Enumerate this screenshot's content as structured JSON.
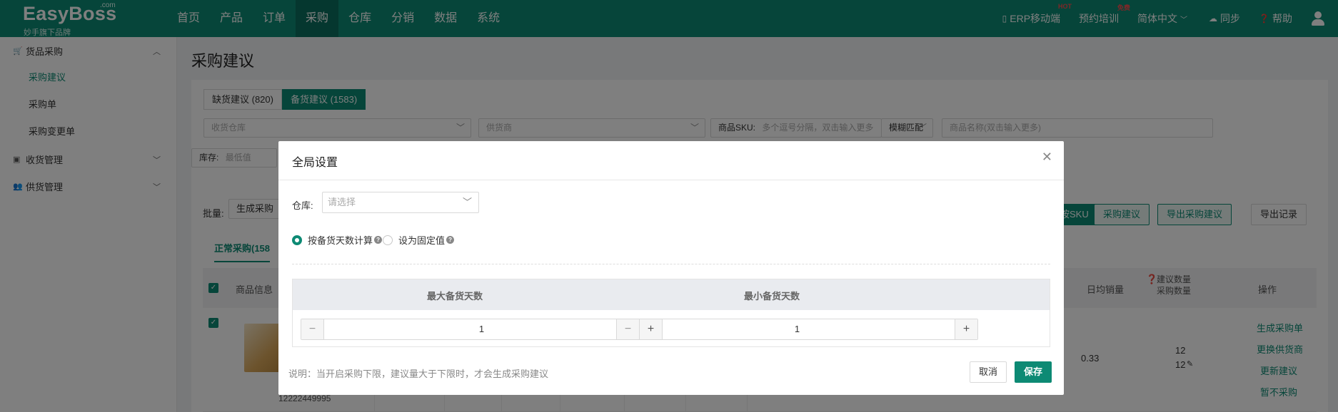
{
  "brand": {
    "name": "EasyBoss",
    "com": ".com",
    "slogan": "妙手旗下品牌"
  },
  "nav": {
    "items": [
      "首页",
      "产品",
      "订单",
      "采购",
      "仓库",
      "分销",
      "数据",
      "系统"
    ],
    "active": "采购"
  },
  "top_right": {
    "erp": "ERP移动端",
    "erp_badge": "HOT",
    "training": "预约培训",
    "training_badge": "免费",
    "language": "简体中文",
    "sync": "同步",
    "help": "帮助"
  },
  "sidebar": {
    "group_purchase": "货品采购",
    "items": [
      "采购建议",
      "采购单",
      "采购变更单"
    ],
    "group_receive": "收货管理",
    "group_supplier": "供货管理"
  },
  "page": {
    "title": "采购建议",
    "tab_shortage": "缺货建议 (820)",
    "tab_stock": "备货建议 (1583)",
    "filter_warehouse": "收货仓库",
    "filter_supplier": "供货商",
    "filter_sku_label": "商品SKU:",
    "filter_sku_placeholder": "多个逗号分隔，双击输入更多",
    "filter_match": "模糊匹配",
    "filter_name_placeholder": "商品名称(双击输入更多)",
    "filter_stock_label": "库存:",
    "filter_stock_min": "最低值",
    "batch_label": "批量:",
    "batch_btn": "生成采购",
    "btn_sku": "按SKU",
    "btn_suggest": "采购建议",
    "btn_export": "导出采购建议",
    "btn_export_log": "导出记录",
    "tab_normal": "正常采购(158",
    "col_product": "商品信息",
    "col_avg_sales": "日均销量",
    "col_suggest_qty": "建议数量",
    "col_purchase_qty": "采购数量",
    "col_ops": "操作",
    "row": {
      "sku_tail": "12222449995",
      "avg": "0.33",
      "suggest": "12",
      "purchase": "12",
      "ops": [
        "生成采购单",
        "更换供货商",
        "更新建议",
        "暂不采购"
      ]
    }
  },
  "modal": {
    "title": "全局设置",
    "warehouse_label": "仓库:",
    "warehouse_placeholder": "请选择",
    "radio_days": "按备货天数计算",
    "radio_fixed": "设为固定值",
    "col_max": "最大备货天数",
    "col_min": "最小备货天数",
    "max_value": "1",
    "min_value": "1",
    "note": "说明：当开启采购下限，建议量大于下限时，才会生成采购建议",
    "cancel": "取消",
    "save": "保存"
  }
}
